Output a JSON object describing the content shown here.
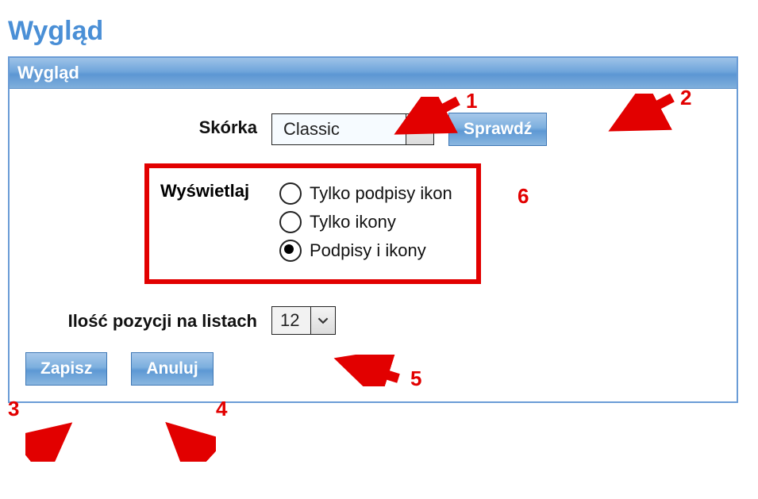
{
  "page": {
    "title": "Wygląd"
  },
  "panel": {
    "header": "Wygląd"
  },
  "skin": {
    "label": "Skórka",
    "value": "Classic",
    "check_button": "Sprawdź"
  },
  "display": {
    "label": "Wyświetlaj",
    "options": [
      {
        "label": "Tylko podpisy ikon",
        "checked": false
      },
      {
        "label": "Tylko ikony",
        "checked": false
      },
      {
        "label": "Podpisy i ikony",
        "checked": true
      }
    ]
  },
  "list_count": {
    "label": "Ilość pozycji na listach",
    "value": "12"
  },
  "buttons": {
    "save": "Zapisz",
    "cancel": "Anuluj"
  },
  "annotations": {
    "a1": "1",
    "a2": "2",
    "a3": "3",
    "a4": "4",
    "a5": "5",
    "a6": "6"
  }
}
